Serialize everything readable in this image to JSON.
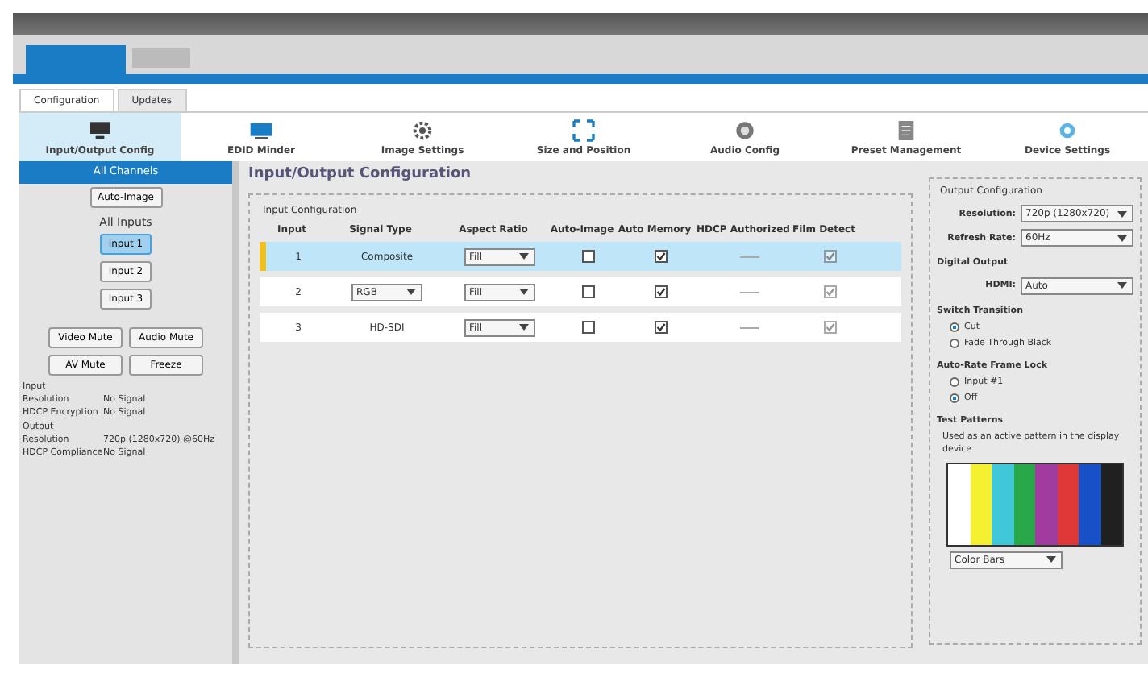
{
  "tabs": [
    {
      "label": "Configuration",
      "selected": true
    },
    {
      "label": "Updates",
      "selected": false
    }
  ],
  "toolbar": [
    {
      "label": "Input/Output Config",
      "selected": true
    },
    {
      "label": "EDID Minder",
      "selected": false
    },
    {
      "label": "Image Settings",
      "selected": false
    },
    {
      "label": "Size and Position",
      "selected": false
    },
    {
      "label": "Audio Config",
      "selected": false
    },
    {
      "label": "Preset Management",
      "selected": false
    },
    {
      "label": "Device Settings",
      "selected": false
    }
  ],
  "sidebar": {
    "header": "All Channels",
    "auto_image": "Auto-Image",
    "inputs_label": "All Inputs",
    "inputs": [
      {
        "label": "Input 1",
        "selected": true
      },
      {
        "label": "Input 2",
        "selected": false
      },
      {
        "label": "Input 3",
        "selected": false
      }
    ],
    "buttons": [
      "Video Mute",
      "Audio Mute",
      "AV Mute",
      "Freeze"
    ],
    "status": [
      {
        "title": "Input",
        "rows": [
          [
            "Resolution",
            "No Signal"
          ],
          [
            "HDCP Encryption",
            "No Signal"
          ]
        ]
      },
      {
        "title": "Output",
        "rows": [
          [
            "Resolution",
            "720p (1280x720) @60Hz"
          ],
          [
            "HDCP Compliance",
            "No Signal"
          ]
        ]
      }
    ]
  },
  "page_title": "Input/Output Configuration",
  "input_config": {
    "legend": "Input Configuration",
    "columns": [
      "Input",
      "Signal Type",
      "Aspect Ratio",
      "Auto-Image",
      "Auto Memory",
      "HDCP Authorized",
      "Film Detect"
    ],
    "rows": [
      {
        "input": "1",
        "signal_type": "Composite",
        "signal_dropdown": false,
        "aspect": "Fill",
        "auto_image": false,
        "auto_memory": true,
        "film_detect": true,
        "selected": true
      },
      {
        "input": "2",
        "signal_type": "RGB",
        "signal_dropdown": true,
        "aspect": "Fill",
        "auto_image": false,
        "auto_memory": true,
        "film_detect": true,
        "selected": false
      },
      {
        "input": "3",
        "signal_type": "HD-SDI",
        "signal_dropdown": false,
        "aspect": "Fill",
        "auto_image": false,
        "auto_memory": true,
        "film_detect": true,
        "selected": false
      }
    ]
  },
  "output_config": {
    "legend": "Output Configuration",
    "fields": [
      {
        "label": "Resolution:",
        "value": "720p (1280x720)"
      },
      {
        "label": "Refresh Rate:",
        "value": "60Hz"
      }
    ],
    "digital_output": "Digital Output",
    "hdmi": {
      "label": "HDMI:",
      "value": "Auto"
    },
    "switch_transition": {
      "title": "Switch Transition",
      "options": [
        {
          "label": "Cut",
          "selected": true
        },
        {
          "label": "Fade Through Black",
          "selected": false
        }
      ]
    },
    "frame_lock": {
      "title": "Auto-Rate Frame Lock",
      "options": [
        {
          "label": "Input #1",
          "selected": false
        },
        {
          "label": "Off",
          "selected": true
        }
      ]
    },
    "test_patterns": {
      "title": "Test Patterns",
      "description": "Used as an active pattern in the display device",
      "bars": [
        {
          "color": "#ffffff"
        },
        {
          "color": "#f5f030"
        },
        {
          "color": "#40c8d8"
        },
        {
          "color": "#28a848"
        },
        {
          "color": "#a03ca0"
        },
        {
          "color": "#e03838"
        },
        {
          "color": "#1850c8"
        },
        {
          "color": "#202020"
        }
      ],
      "value": "Color Bars"
    }
  }
}
